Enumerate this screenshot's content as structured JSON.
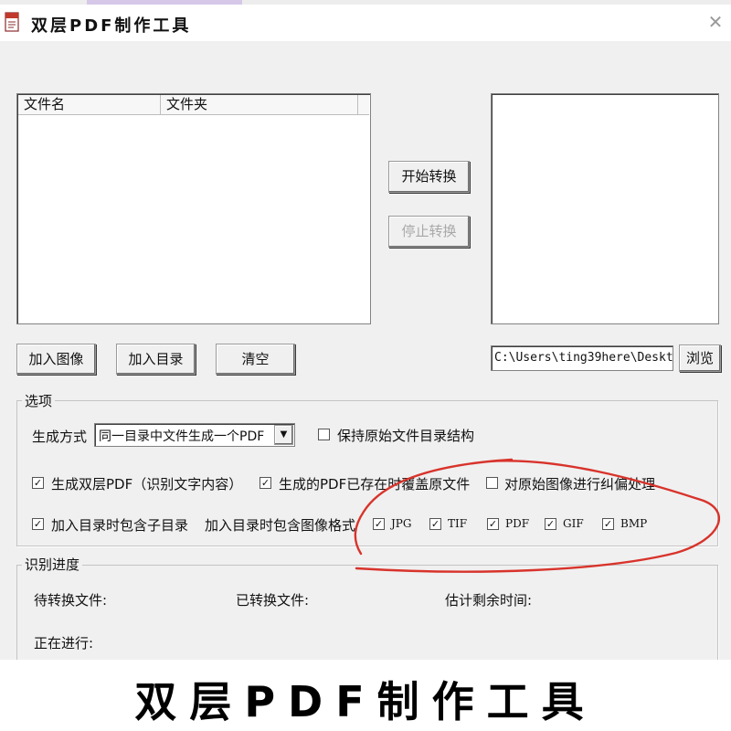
{
  "window": {
    "title": "双层PDF制作工具"
  },
  "file_list": {
    "columns": [
      "文件名",
      "文件夹"
    ]
  },
  "buttons": {
    "start": "开始转换",
    "stop": "停止转换",
    "add_image": "加入图像",
    "add_folder": "加入目录",
    "clear": "清空",
    "browse": "浏览"
  },
  "output_path": "C:\\Users\\ting39here\\Desktop",
  "options": {
    "legend": "选项",
    "mode_label": "生成方式",
    "mode_value": "同一目录中文件生成一个PDF",
    "keep_structure": {
      "label": "保持原始文件目录结构",
      "checked": false
    },
    "dual_layer": {
      "label": "生成双层PDF（识别文字内容）",
      "checked": true
    },
    "overwrite": {
      "label": "生成的PDF已存在时覆盖原文件",
      "checked": true
    },
    "deskew": {
      "label": "对原始图像进行纠偏处理",
      "checked": false
    },
    "include_subdirs": {
      "label": "加入目录时包含子目录",
      "checked": true
    },
    "formats_label": "加入目录时包含图像格式",
    "formats": [
      {
        "label": "JPG",
        "checked": true
      },
      {
        "label": "TIF",
        "checked": true
      },
      {
        "label": "PDF",
        "checked": true
      },
      {
        "label": "GIF",
        "checked": true
      },
      {
        "label": "BMP",
        "checked": true
      }
    ]
  },
  "progress": {
    "legend": "识别进度",
    "pending_label": "待转换文件:",
    "converted_label": "已转换文件:",
    "remaining_label": "估计剩余时间:",
    "in_progress_label": "正在进行:"
  },
  "banner": {
    "text": "双层PDF制作工具"
  },
  "colors": {
    "annotation_red": "#d8332b",
    "window_bg": "#f0f0f0"
  },
  "icons": {
    "app": "pdf-document-icon",
    "close": "close-icon",
    "dropdown": "chevron-down-icon",
    "checkmark": "check-icon"
  }
}
